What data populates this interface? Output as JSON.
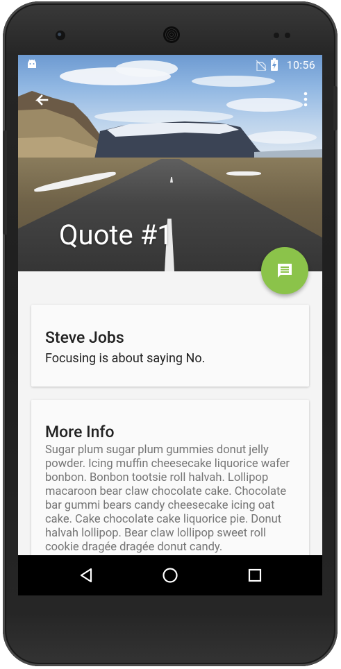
{
  "status_bar": {
    "time": "10:56"
  },
  "toolbar": {
    "back_icon": "arrow-back-icon",
    "overflow_icon": "more-vert-icon"
  },
  "header": {
    "title": "Quote #1",
    "image": "mountain-road-photo"
  },
  "fab": {
    "icon": "chat-message-icon",
    "color": "#8bc34a"
  },
  "quote_card": {
    "author": "Steve Jobs",
    "quote": "Focusing is about saying No."
  },
  "info_card": {
    "title": "More Info",
    "body": "Sugar plum sugar plum gummies donut jelly powder. Icing muffin cheesecake liquorice wafer bonbon. Bonbon tootsie roll halvah. Lollipop macaroon bear claw chocolate cake. Chocolate bar gummi bears candy cheesecake icing oat cake. Cake chocolate cake liquorice pie. Donut halvah lollipop. Bear claw lollipop sweet roll cookie dragée dragée donut candy."
  },
  "nav_bar": {
    "back": "triangle-back-icon",
    "home": "circle-home-icon",
    "recents": "square-recents-icon"
  }
}
